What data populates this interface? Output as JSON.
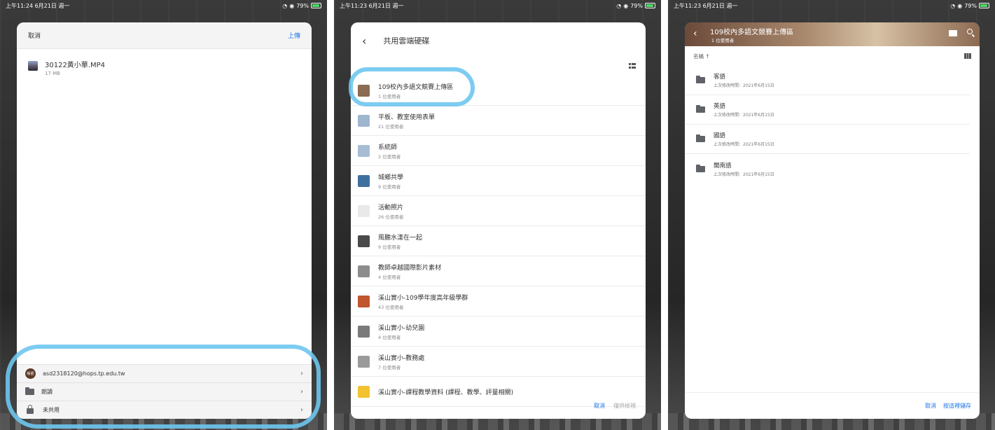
{
  "panel1": {
    "status": {
      "time": "上午11:24  6月21日 週一",
      "battery": "79%"
    },
    "header": {
      "cancel": "取消",
      "upload": "上傳"
    },
    "file": {
      "name": "30122黃小華.MP4",
      "size": "17 MB"
    },
    "destinations": [
      {
        "label": "asd2318120@hops.tp.edu.tw",
        "icon": "avatar"
      },
      {
        "label": "朗讀",
        "icon": "folder-icon"
      },
      {
        "label": "未共用",
        "icon": "lock-icon"
      }
    ]
  },
  "panel2": {
    "status": {
      "time": "上午11:23  6月21日 週一",
      "battery": "79%"
    },
    "title": "共用雲端硬碟",
    "drives": [
      {
        "name": "109校內多語文競賽上傳區",
        "users": "1 位使用者",
        "color": "#8b6b52"
      },
      {
        "name": "平板、教室使用表單",
        "users": "21 位使用者",
        "color": "#9fb6cf"
      },
      {
        "name": "系統師",
        "users": "2 位使用者",
        "color": "#a7bdd3"
      },
      {
        "name": "城鄉共學",
        "users": "9 位使用者",
        "color": "#3f6f9f"
      },
      {
        "name": "活動照片",
        "users": "26 位使用者",
        "color": "#e9e9e9"
      },
      {
        "name": "風聽水漾在一起",
        "users": "9 位使用者",
        "color": "#4a4a4a"
      },
      {
        "name": "教師卓越國際影片素材",
        "users": "4 位使用者",
        "color": "#8d8d8d"
      },
      {
        "name": "溪山實小-109學年度高年級學群",
        "users": "43 位使用者",
        "color": "#c0552e"
      },
      {
        "name": "溪山實小-幼兒園",
        "users": "4 位使用者",
        "color": "#7a7a7a"
      },
      {
        "name": "溪山實小-教務處",
        "users": "7 位使用者",
        "color": "#9a9a9a"
      },
      {
        "name": "溪山實小-課程教學資料 (課程、教學、評量相關)",
        "users": "",
        "color": "#f2c230"
      }
    ],
    "footer": {
      "cancel": "取消",
      "select": "僅供檢視"
    }
  },
  "panel3": {
    "status": {
      "time": "上午11:23  6月21日 週一",
      "battery": "79%"
    },
    "title": "109校內多語文競賽上傳區",
    "subtitle": "1 位使用者",
    "sort_label": "名稱 ↑",
    "folders": [
      {
        "name": "客語",
        "meta": "上次修改時間：2021年6月15日"
      },
      {
        "name": "英語",
        "meta": "上次修改時間：2021年6月15日"
      },
      {
        "name": "國語",
        "meta": "上次修改時間：2021年6月15日"
      },
      {
        "name": "閩南語",
        "meta": "上次修改時間：2021年6月15日"
      }
    ],
    "footer": {
      "cancel": "取消",
      "save": "按這裡儲存"
    }
  }
}
